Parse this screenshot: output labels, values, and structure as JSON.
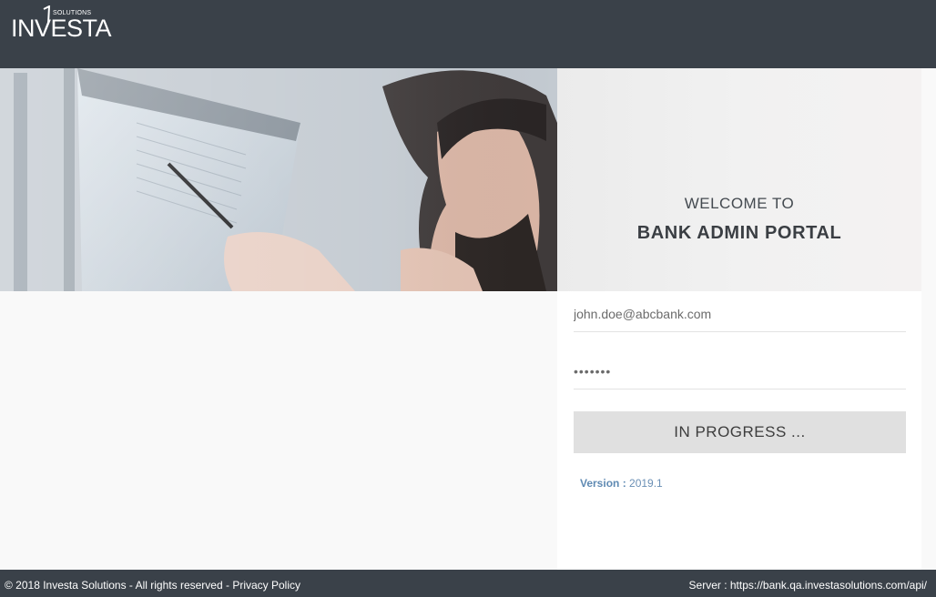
{
  "header": {
    "logo": {
      "brand": "INVESTA",
      "sub": "SOLUTIONS",
      "icon": "investa-logo-icon"
    }
  },
  "hero": {
    "image": "office-man-pointing-at-monitor-photo"
  },
  "login": {
    "welcome": "WELCOME TO",
    "portal_name": "BANK ADMIN PORTAL",
    "email_value": "john.doe@abcbank.com",
    "password_value": "•••••••",
    "submit_label": "IN PROGRESS ...",
    "version_label": "Version :",
    "version_value": "2019.1"
  },
  "footer": {
    "copyright": "© 2018 Investa Solutions - All rights reserved -",
    "privacy_link": "Privacy Policy",
    "server_label": "Server :",
    "server_url": "https://bank.qa.investasolutions.com/api/"
  },
  "colors": {
    "topbar": "#3a4149",
    "button_bg": "#e0e0e0",
    "version_text": "#5f8ab3"
  }
}
